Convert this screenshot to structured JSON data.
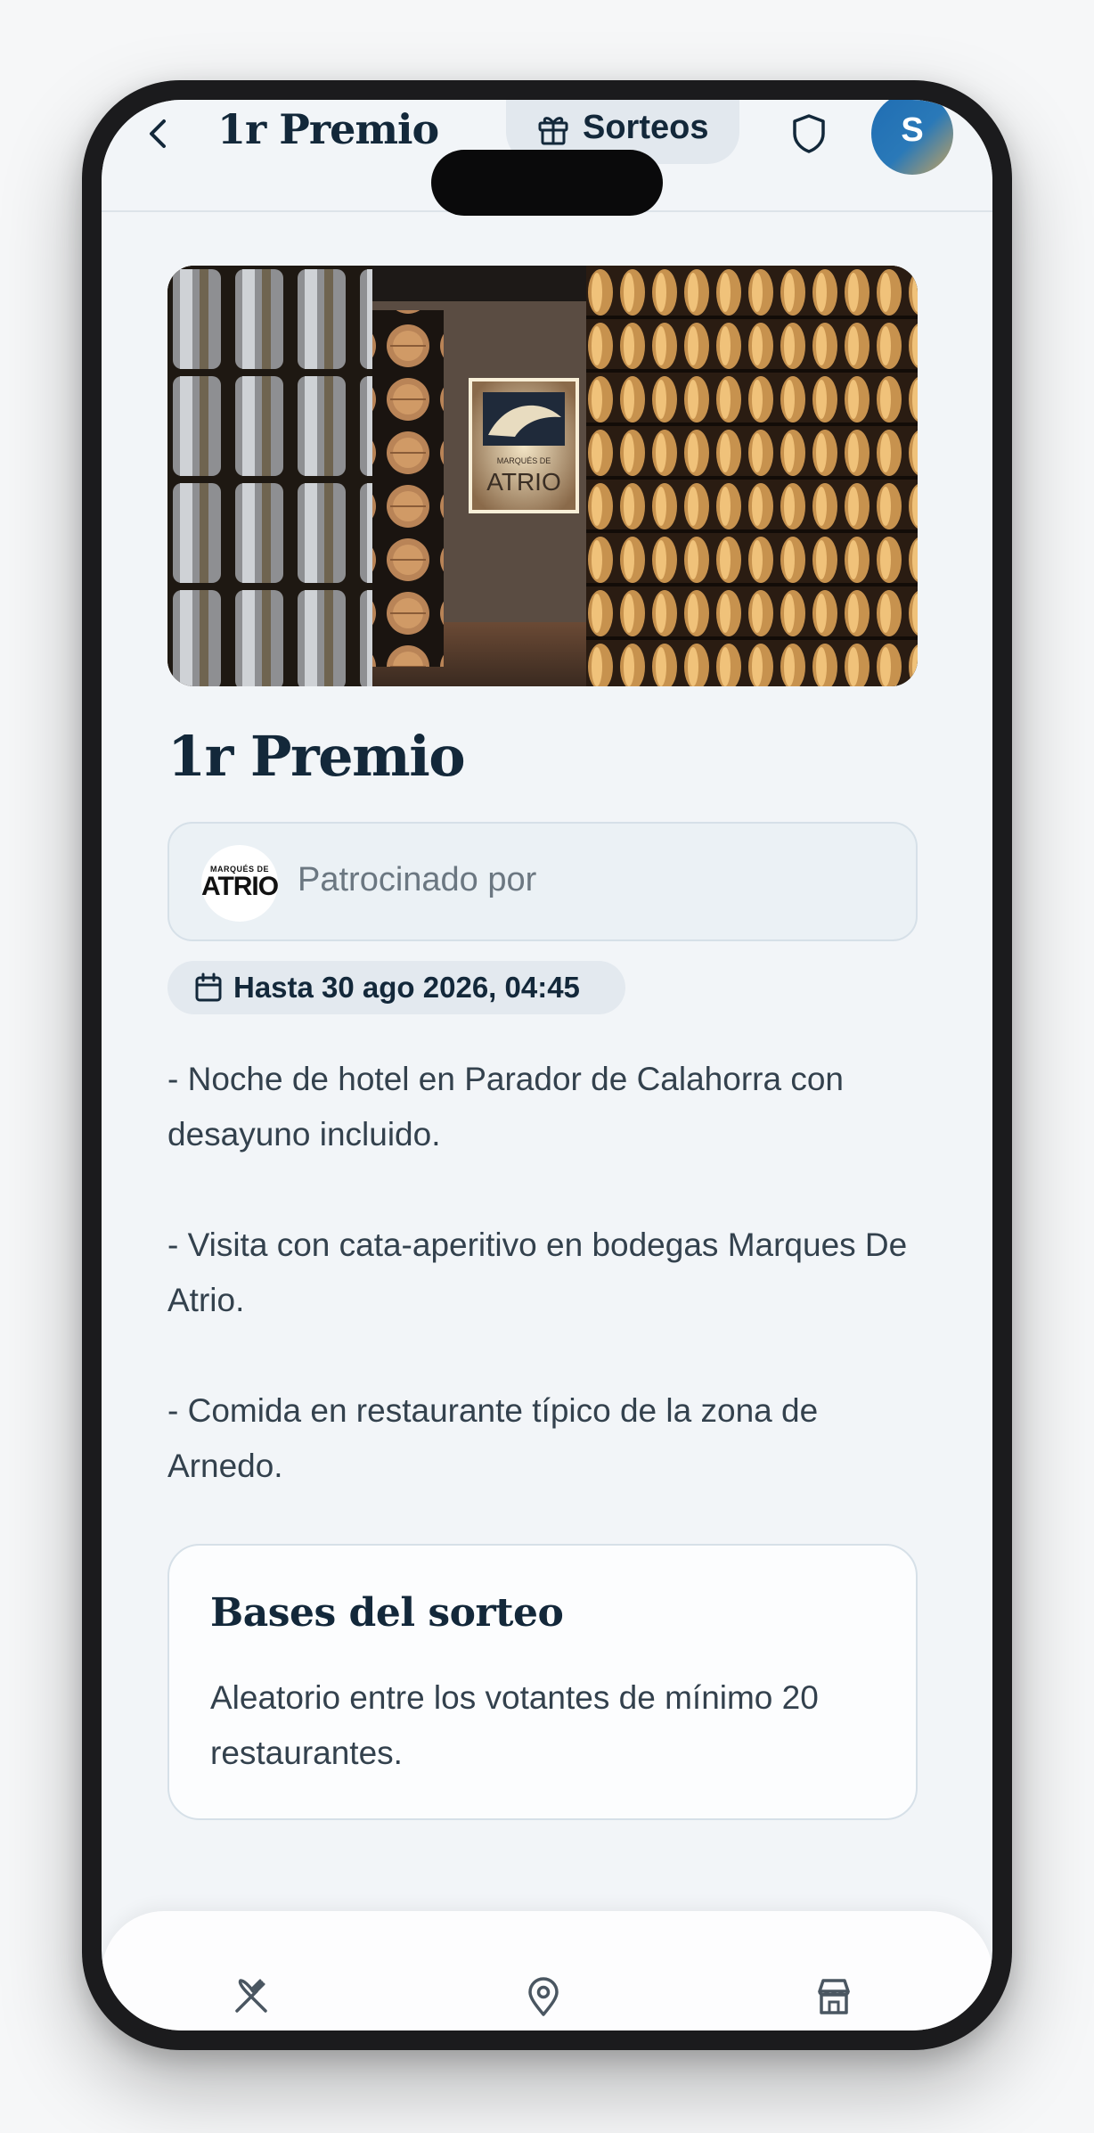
{
  "header": {
    "title": "1r Premio",
    "sorteos_label": "Sorteos",
    "avatar_initial": "S"
  },
  "hero": {
    "sign_small": "MARQUÉS DE",
    "sign_big": "ATRIO"
  },
  "prize": {
    "title": "1r Premio",
    "sponsor_label": "Patrocinado por",
    "sponsor_logo_small": "MARQUÉS DE",
    "sponsor_logo_big": "ATRIO",
    "deadline": "Hasta 30 ago 2026, 04:45",
    "description": [
      "- Noche de hotel en Parador de Calahorra con desayuno incluido.",
      "- Visita con cata-aperitivo en bodegas Marques De Atrio.",
      "- Comida en restaurante típico de la zona de Arnedo."
    ]
  },
  "rules": {
    "title": "Bases del sorteo",
    "text": "Aleatorio entre los votantes de mínimo 20 restaurantes."
  },
  "bottom_nav": {
    "items": [
      "restaurants-icon",
      "map-pin-icon",
      "store-icon"
    ]
  },
  "colors": {
    "heading": "#13283a",
    "body_text": "#33414d",
    "background": "#f2f5f8",
    "chip": "#e3e9ef"
  }
}
